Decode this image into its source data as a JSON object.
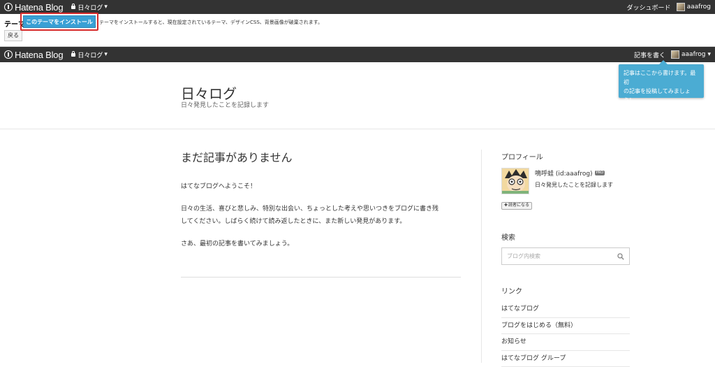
{
  "topbar": {
    "brand": "Hatena Blog",
    "blog_menu": "日々ログ",
    "dashboard": "ダッシュボード",
    "username": "aaafrog"
  },
  "preview": {
    "title": "テーマをプレビュー：Blank",
    "back_label": "戻る",
    "install_label": "このテーマをインストール",
    "note": "テーマをインストールすると、現在設定されているテーマ、デザインCSS、背景画像が破棄されます。"
  },
  "header2": {
    "brand": "Hatena Blog",
    "blog_menu": "日々ログ",
    "write_label": "記事を書く",
    "username": "aaafrog"
  },
  "tooltip": {
    "text_line1": "記事はここから書けます。最初",
    "text_line2": "の記事を投稿してみましょう！"
  },
  "blog": {
    "title": "日々ログ",
    "description": "日々発見したことを記録します"
  },
  "main": {
    "heading": "まだ記事がありません",
    "p1": "はてなブログへようこそ！",
    "p2_line1": "日々の生活、喜びと悲しみ、特別な出会い、ちょっとした考えや思いつきをブログに書き残",
    "p2_line2": "してください。しばらく続けて読み返したときに、また新しい発見があります。",
    "p3": "さあ、最初の記事を書いてみましょう。"
  },
  "sidebar": {
    "profile_title": "プロフィール",
    "profile_name": "鳴呼蛙 (id:aaafrog)",
    "pro_badge": "PRO",
    "profile_desc": "日々発見したことを記録します",
    "reader_label": "読者になる",
    "search_title": "検索",
    "search_placeholder": "ブログ内検索",
    "links_title": "リンク",
    "links": [
      "はてなブログ",
      "ブログをはじめる（無料）",
      "お知らせ",
      "はてなブログ グループ"
    ]
  }
}
